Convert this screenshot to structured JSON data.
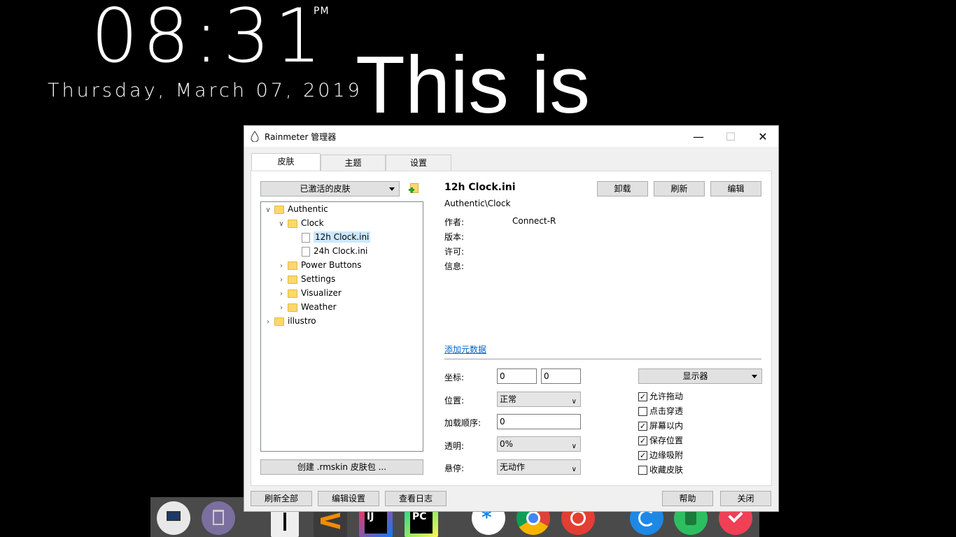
{
  "desktop": {
    "time": "08:31",
    "ampm": "PM",
    "date": "Thursday, March 07, 2019",
    "big_text": "This is"
  },
  "window": {
    "title": "Rainmeter 管理器",
    "controls": {
      "minimize": "—",
      "maximize": "☐",
      "close": "✕"
    },
    "tabs": [
      {
        "label": "皮肤",
        "active": true
      },
      {
        "label": "主题",
        "active": false
      },
      {
        "label": "设置",
        "active": false
      }
    ],
    "skins": {
      "dropdown_label": "已激活的皮肤",
      "tree": [
        {
          "label": "Authentic",
          "type": "folder",
          "expanded": true
        },
        {
          "label": "Clock",
          "type": "folder",
          "expanded": true
        },
        {
          "label": "12h Clock.ini",
          "type": "file",
          "selected": true
        },
        {
          "label": "24h Clock.ini",
          "type": "file"
        },
        {
          "label": "Power Buttons",
          "type": "folder"
        },
        {
          "label": "Settings",
          "type": "folder"
        },
        {
          "label": "Visualizer",
          "type": "folder"
        },
        {
          "label": "Weather",
          "type": "folder"
        },
        {
          "label": "illustro",
          "type": "folder"
        }
      ],
      "create_button": "创建 .rmskin 皮肤包 ..."
    },
    "detail": {
      "name": "12h Clock.ini",
      "path": "Authentic\\Clock",
      "buttons": {
        "unload": "卸载",
        "refresh": "刷新",
        "edit": "编辑"
      },
      "meta": [
        {
          "label": "作者:",
          "value": "Connect-R"
        },
        {
          "label": "版本:",
          "value": ""
        },
        {
          "label": "许可:",
          "value": ""
        },
        {
          "label": "信息:",
          "value": ""
        }
      ],
      "add_metadata": "添加元数据",
      "coords_label": "坐标:",
      "x": "0",
      "y": "0",
      "position_label": "位置:",
      "position_value": "正常",
      "load_order_label": "加载顺序:",
      "load_order_value": "0",
      "transparency_label": "透明:",
      "transparency_value": "0%",
      "hover_label": "悬停:",
      "hover_value": "无动作",
      "display_dropdown": "显示器",
      "checkboxes": [
        {
          "label": "允许拖动",
          "checked": true
        },
        {
          "label": "点击穿透",
          "checked": false
        },
        {
          "label": "屏幕以内",
          "checked": true
        },
        {
          "label": "保存位置",
          "checked": true
        },
        {
          "label": "边缘吸附",
          "checked": true
        },
        {
          "label": "收藏皮肤",
          "checked": false
        }
      ]
    },
    "footer": {
      "refresh_all": "刷新全部",
      "edit_settings": "编辑设置",
      "view_log": "查看日志",
      "help": "帮助",
      "close": "关闭"
    },
    "check_mark": "✓"
  },
  "dock_icons": [
    "finder-icon",
    "trash-icon",
    "notes-icon",
    "sublime-icon",
    "intellij-icon",
    "pycharm-icon",
    "asterisk-icon",
    "chrome-icon",
    "netease-music-icon",
    "browser-icon",
    "evernote-icon",
    "pocket-icon"
  ]
}
